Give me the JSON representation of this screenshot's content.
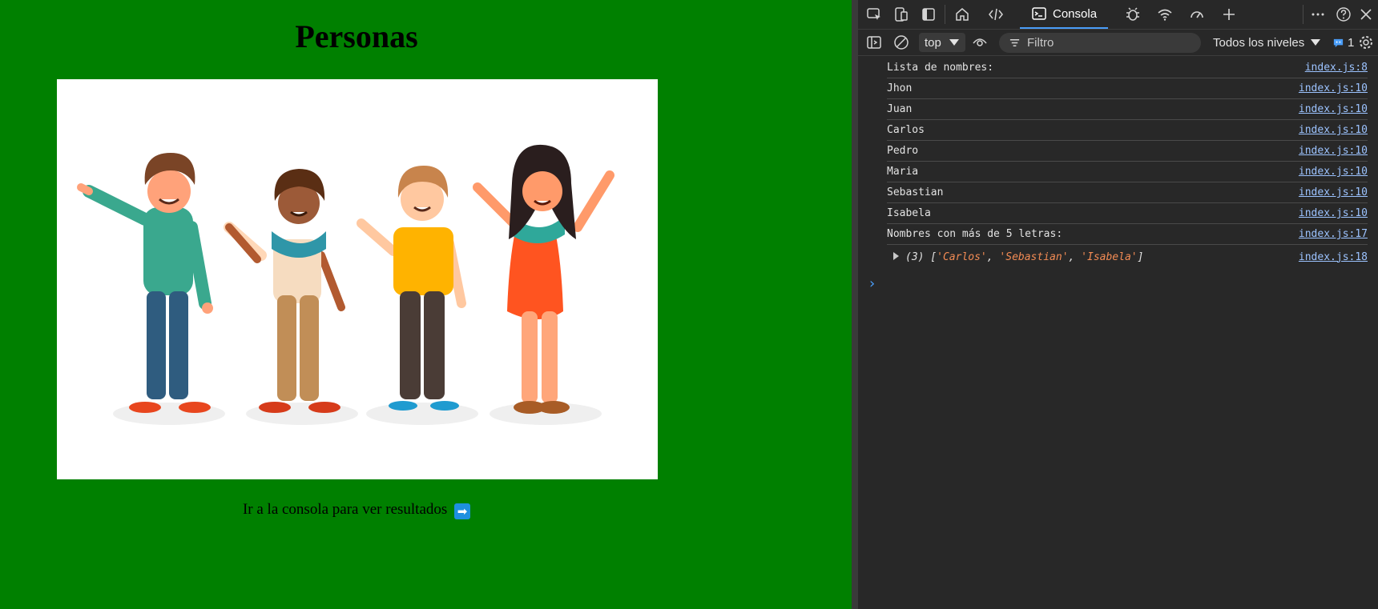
{
  "page": {
    "title": "Personas",
    "caption": "Ir a la consola para ver resultados",
    "caption_icon": "right-arrow-icon",
    "background_color": "#008000",
    "image_description_icon": "four-waving-people-illustration"
  },
  "devtools": {
    "tabs": {
      "console_label": "Consola",
      "icons": [
        "inspect-icon",
        "device-emulation-icon",
        "dock-icon",
        "home-icon",
        "code-icon",
        "console-icon",
        "bug-icon",
        "wifi-icon",
        "performance-icon",
        "add-tab-icon",
        "more-icon",
        "help-icon",
        "close-icon"
      ]
    },
    "toolbar": {
      "context": "top",
      "filter_placeholder": "Filtro",
      "levels_label": "Todos los niveles",
      "issues_count": "1"
    },
    "log": [
      {
        "text": "Lista de nombres:",
        "source": "index.js:8"
      },
      {
        "text": "Jhon",
        "source": "index.js:10"
      },
      {
        "text": "Juan",
        "source": "index.js:10"
      },
      {
        "text": "Carlos",
        "source": "index.js:10"
      },
      {
        "text": "Pedro",
        "source": "index.js:10"
      },
      {
        "text": "Maria",
        "source": "index.js:10"
      },
      {
        "text": "Sebastian",
        "source": "index.js:10"
      },
      {
        "text": "Isabela",
        "source": "index.js:10"
      },
      {
        "text": "Nombres con más de 5 letras:",
        "source": "index.js:17"
      }
    ],
    "array_entry": {
      "count": "(3)",
      "items": [
        "'Carlos'",
        "'Sebastian'",
        "'Isabela'"
      ],
      "source": "index.js:18"
    },
    "prompt": "›",
    "accent_color": "#4a9df8"
  }
}
